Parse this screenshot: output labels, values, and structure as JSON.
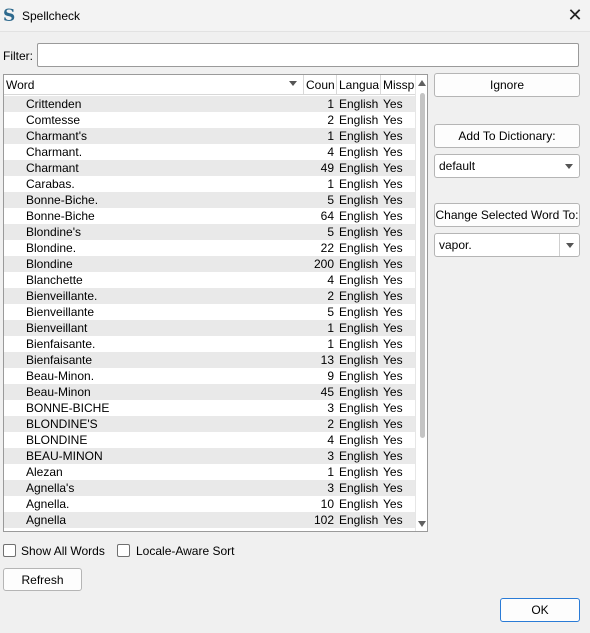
{
  "window": {
    "title": "Spellcheck",
    "app_icon_glyph": "S",
    "close_glyph": "✕"
  },
  "filter": {
    "label": "Filter:",
    "value": ""
  },
  "table": {
    "columns": [
      "Word",
      "Coun",
      "Langua",
      "Missp"
    ],
    "rows": [
      {
        "word": "Crittenden",
        "count": "1",
        "language": "English",
        "misspelled": "Yes"
      },
      {
        "word": "Comtesse",
        "count": "2",
        "language": "English",
        "misspelled": "Yes"
      },
      {
        "word": "Charmant's",
        "count": "1",
        "language": "English",
        "misspelled": "Yes"
      },
      {
        "word": "Charmant.",
        "count": "4",
        "language": "English",
        "misspelled": "Yes"
      },
      {
        "word": "Charmant",
        "count": "49",
        "language": "English",
        "misspelled": "Yes"
      },
      {
        "word": "Carabas.",
        "count": "1",
        "language": "English",
        "misspelled": "Yes"
      },
      {
        "word": "Bonne-Biche.",
        "count": "5",
        "language": "English",
        "misspelled": "Yes"
      },
      {
        "word": "Bonne-Biche",
        "count": "64",
        "language": "English",
        "misspelled": "Yes"
      },
      {
        "word": "Blondine's",
        "count": "5",
        "language": "English",
        "misspelled": "Yes"
      },
      {
        "word": "Blondine.",
        "count": "22",
        "language": "English",
        "misspelled": "Yes"
      },
      {
        "word": "Blondine",
        "count": "200",
        "language": "English",
        "misspelled": "Yes"
      },
      {
        "word": "Blanchette",
        "count": "4",
        "language": "English",
        "misspelled": "Yes"
      },
      {
        "word": "Bienveillante.",
        "count": "2",
        "language": "English",
        "misspelled": "Yes"
      },
      {
        "word": "Bienveillante",
        "count": "5",
        "language": "English",
        "misspelled": "Yes"
      },
      {
        "word": "Bienveillant",
        "count": "1",
        "language": "English",
        "misspelled": "Yes"
      },
      {
        "word": "Bienfaisante.",
        "count": "1",
        "language": "English",
        "misspelled": "Yes"
      },
      {
        "word": "Bienfaisante",
        "count": "13",
        "language": "English",
        "misspelled": "Yes"
      },
      {
        "word": "Beau-Minon.",
        "count": "9",
        "language": "English",
        "misspelled": "Yes"
      },
      {
        "word": "Beau-Minon",
        "count": "45",
        "language": "English",
        "misspelled": "Yes"
      },
      {
        "word": "BONNE-BICHE",
        "count": "3",
        "language": "English",
        "misspelled": "Yes"
      },
      {
        "word": "BLONDINE'S",
        "count": "2",
        "language": "English",
        "misspelled": "Yes"
      },
      {
        "word": "BLONDINE",
        "count": "4",
        "language": "English",
        "misspelled": "Yes"
      },
      {
        "word": "BEAU-MINON",
        "count": "3",
        "language": "English",
        "misspelled": "Yes"
      },
      {
        "word": "Alezan",
        "count": "1",
        "language": "English",
        "misspelled": "Yes"
      },
      {
        "word": "Agnella's",
        "count": "3",
        "language": "English",
        "misspelled": "Yes"
      },
      {
        "word": "Agnella.",
        "count": "10",
        "language": "English",
        "misspelled": "Yes"
      },
      {
        "word": "Agnella",
        "count": "102",
        "language": "English",
        "misspelled": "Yes"
      }
    ]
  },
  "actions": {
    "ignore": "Ignore",
    "add_to_dictionary": "Add To Dictionary:",
    "dictionary_selected": "default",
    "change_selected_word": "Change Selected Word To:",
    "replacement_value": "vapor."
  },
  "options": {
    "show_all_words": "Show All Words",
    "show_all_words_checked": false,
    "locale_aware_sort": "Locale-Aware Sort",
    "locale_aware_sort_checked": false
  },
  "buttons": {
    "refresh": "Refresh",
    "ok": "OK"
  },
  "colors": {
    "ok_border": "#2a7bd6",
    "row_stripe": "#e9e9e9"
  }
}
